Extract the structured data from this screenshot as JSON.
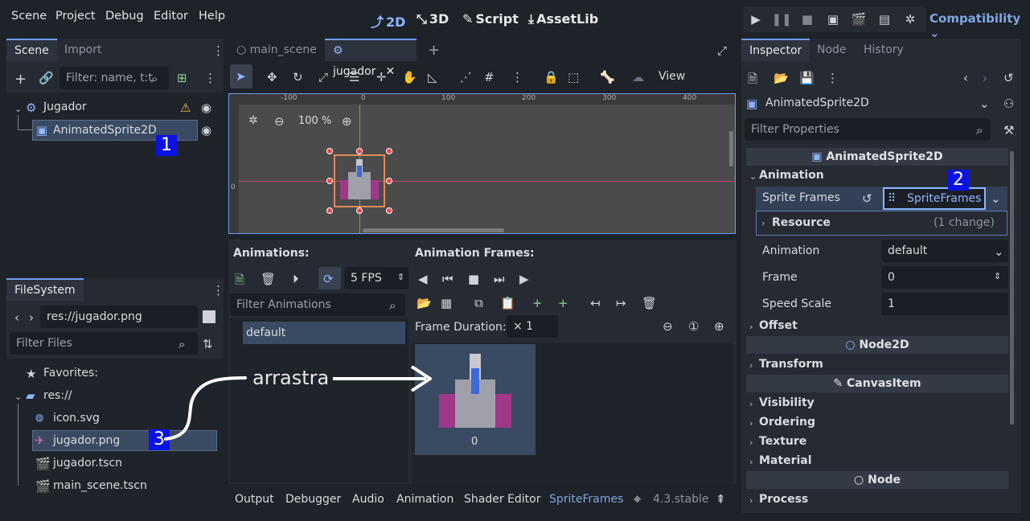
{
  "menu": [
    "Scene",
    "Project",
    "Debug",
    "Editor",
    "Help"
  ],
  "workspaces": {
    "w2d": "2D",
    "w3d": "3D",
    "script": "Script",
    "assetlib": "AssetLib"
  },
  "renderer": "Compatibility",
  "scene_dock": {
    "tabs": [
      "Scene",
      "Import"
    ],
    "filter_placeholder": "Filter: name, t:t",
    "nodes": [
      {
        "label": "Jugador"
      },
      {
        "label": "AnimatedSprite2D"
      }
    ]
  },
  "filesystem": {
    "tab": "FileSystem",
    "path": "res://jugador.png",
    "filter_placeholder": "Filter Files",
    "items": [
      "Favorites:",
      "res://",
      "icon.svg",
      "jugador.png",
      "jugador.tscn",
      "main_scene.tscn"
    ]
  },
  "editor_tabs": [
    "main_scene",
    "jugador"
  ],
  "toolbar": {
    "view": "View"
  },
  "viewport": {
    "zoom": "100 %",
    "ruler": [
      "-100",
      "0",
      "100",
      "200",
      "300",
      "400"
    ],
    "ruler_v": "0"
  },
  "sprite_frames": {
    "animations_label": "Animations:",
    "frames_label": "Animation Frames:",
    "fps": "5 FPS",
    "filter_animations": "Filter Animations",
    "animation_items": [
      "default"
    ],
    "frame_duration_label": "Frame Duration:",
    "frame_duration": "× 1",
    "frame_index": "0",
    "annotation": "arrastra"
  },
  "bottom_tabs": [
    "Output",
    "Debugger",
    "Audio",
    "Animation",
    "Shader Editor",
    "SpriteFrames"
  ],
  "version": "4.3.stable",
  "inspector": {
    "tabs": [
      "Inspector",
      "Node",
      "History"
    ],
    "object": "AnimatedSprite2D",
    "filter_placeholder": "Filter Properties",
    "header": "AnimatedSprite2D",
    "animation_group": "Animation",
    "sprite_frames_label": "Sprite Frames",
    "sprite_frames_value": "SpriteFrames",
    "resource_label": "Resource",
    "resource_change": "(1 change)",
    "props": [
      {
        "label": "Animation",
        "value": "default"
      },
      {
        "label": "Frame",
        "value": "0"
      },
      {
        "label": "Speed Scale",
        "value": "1"
      }
    ],
    "offset": "Offset",
    "node2d": "Node2D",
    "transform": "Transform",
    "canvasitem": "CanvasItem",
    "groups": [
      "Visibility",
      "Ordering",
      "Texture",
      "Material"
    ],
    "node": "Node",
    "process": "Process"
  },
  "markers": [
    "1",
    "2",
    "3"
  ],
  "colors": {
    "accent": "#6e9ef0",
    "marker": "#0b12e6",
    "selection": "#3a4a62"
  }
}
